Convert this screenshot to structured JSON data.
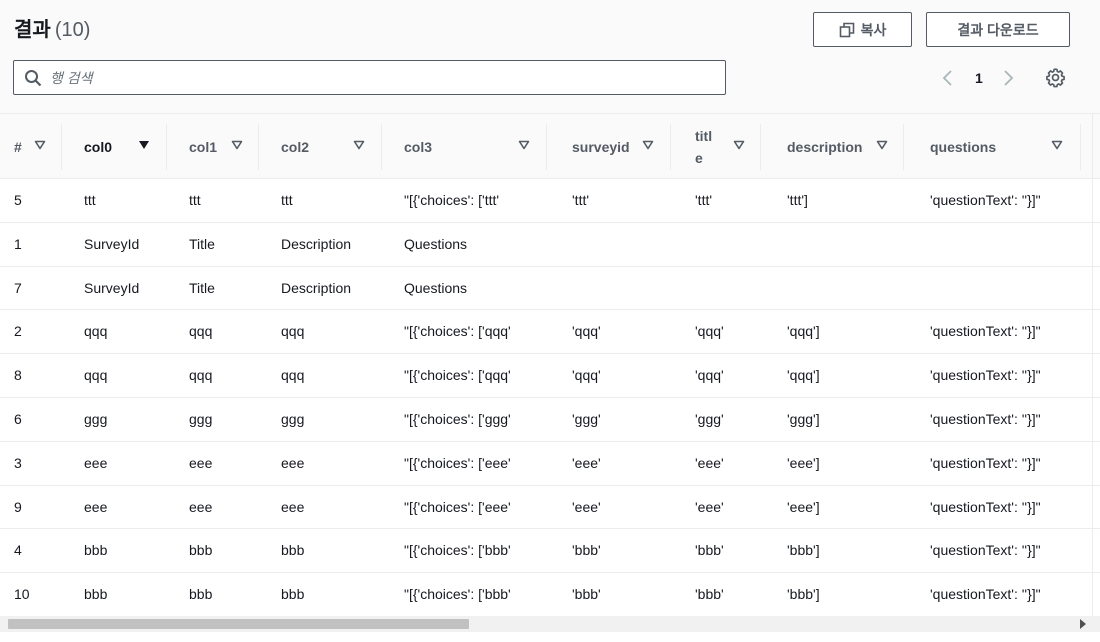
{
  "header": {
    "title": "결과",
    "count": "(10)",
    "copy_label": "복사",
    "download_label": "결과 다운로드"
  },
  "search": {
    "placeholder": "행 검색",
    "value": ""
  },
  "pagination": {
    "current_page": "1"
  },
  "icons": {
    "search": "search-icon",
    "copy": "copy-icon",
    "prev": "chevron-left-icon",
    "next": "chevron-right-icon",
    "settings": "gear-icon",
    "sort": "caret-down-icon"
  },
  "columns": [
    "#",
    "col0",
    "col1",
    "col2",
    "col3",
    "surveyid",
    "titl\ne",
    "description",
    "questions"
  ],
  "sorted_column": "col0",
  "rows": [
    [
      "5",
      "ttt",
      "ttt",
      "ttt",
      "\"[{'choices': ['ttt'",
      "'ttt'",
      "'ttt'",
      "'ttt']",
      "'questionText': ''}]\""
    ],
    [
      "1",
      "SurveyId",
      "Title",
      "Description",
      "Questions",
      "",
      "",
      "",
      ""
    ],
    [
      "7",
      "SurveyId",
      "Title",
      "Description",
      "Questions",
      "",
      "",
      "",
      ""
    ],
    [
      "2",
      "qqq",
      "qqq",
      "qqq",
      "\"[{'choices': ['qqq'",
      "'qqq'",
      "'qqq'",
      "'qqq']",
      "'questionText': ''}]\""
    ],
    [
      "8",
      "qqq",
      "qqq",
      "qqq",
      "\"[{'choices': ['qqq'",
      "'qqq'",
      "'qqq'",
      "'qqq']",
      "'questionText': ''}]\""
    ],
    [
      "6",
      "ggg",
      "ggg",
      "ggg",
      "\"[{'choices': ['ggg'",
      "'ggg'",
      "'ggg'",
      "'ggg']",
      "'questionText': ''}]\""
    ],
    [
      "3",
      "eee",
      "eee",
      "eee",
      "\"[{'choices': ['eee'",
      "'eee'",
      "'eee'",
      "'eee']",
      "'questionText': ''}]\""
    ],
    [
      "9",
      "eee",
      "eee",
      "eee",
      "\"[{'choices': ['eee'",
      "'eee'",
      "'eee'",
      "'eee']",
      "'questionText': ''}]\""
    ],
    [
      "4",
      "bbb",
      "bbb",
      "bbb",
      "\"[{'choices': ['bbb'",
      "'bbb'",
      "'bbb'",
      "'bbb']",
      "'questionText': ''}]\""
    ],
    [
      "10",
      "bbb",
      "bbb",
      "bbb",
      "\"[{'choices': ['bbb'",
      "'bbb'",
      "'bbb'",
      "'bbb']",
      "'questionText': ''}]\""
    ]
  ]
}
